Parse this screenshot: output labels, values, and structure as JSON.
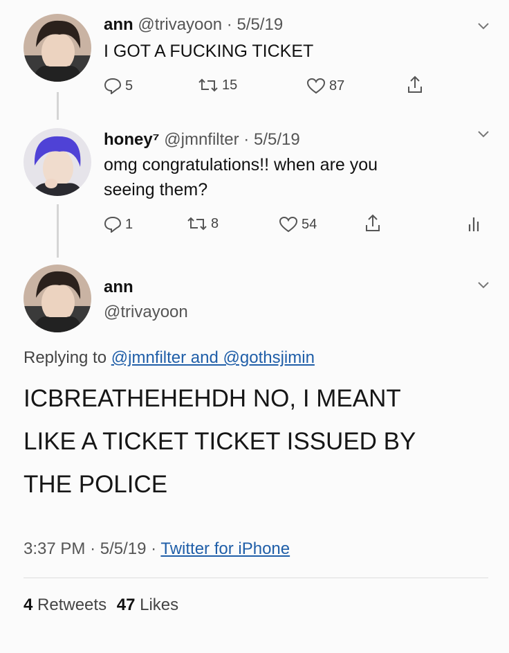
{
  "colors": {
    "background": "#fbfbfb",
    "text": "#141414",
    "meta": "#555555",
    "link": "#1f5ea8",
    "divider": "#dedede"
  },
  "tweet1": {
    "name": "ann",
    "handle": "@trivayoon",
    "sep": "·",
    "date": "5/5/19",
    "text": "I GOT A FUCKING TICKET",
    "replies": "5",
    "retweets": "15",
    "likes": "87",
    "icons": [
      "reply-icon",
      "retweet-icon",
      "like-icon",
      "share-icon",
      "chevron-down-icon"
    ]
  },
  "tweet2": {
    "name": "honey⁷",
    "handle": "@jmnfilter",
    "sep": "·",
    "date": "5/5/19",
    "text_line1": "omg congratulations!! when are you",
    "text_line2": "seeing them?",
    "replies": "1",
    "retweets": "8",
    "likes": "54",
    "icons": [
      "reply-icon",
      "retweet-icon",
      "like-icon",
      "share-icon",
      "analytics-icon",
      "chevron-down-icon"
    ]
  },
  "main_tweet": {
    "name": "ann",
    "handle": "@trivayoon",
    "replying_prefix": "Replying to",
    "replying_to": "@jmnfilter and @gothsjimin",
    "text_line1": "ICBREATHEHEHDH NO, I MEANT",
    "text_line2": "LIKE A TICKET TICKET ISSUED BY",
    "text_line3": "THE POLICE",
    "time": "3:37 PM",
    "sep": "·",
    "date": "5/5/19",
    "source": "Twitter for iPhone",
    "retweet_count": "4",
    "retweet_label": "Retweets",
    "like_count": "47",
    "like_label": "Likes"
  }
}
